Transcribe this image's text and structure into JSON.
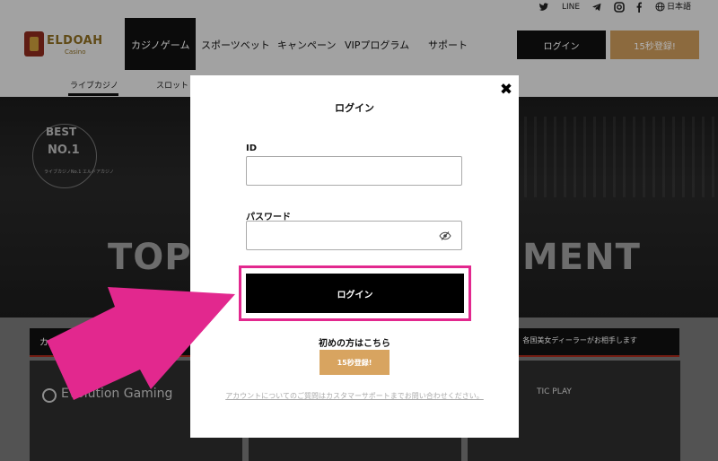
{
  "header": {
    "sns": [
      "LINE"
    ],
    "language": "日本語",
    "logo": {
      "brand": "ELDOAH",
      "sub": "Casino"
    },
    "nav": [
      "カジノゲーム",
      "スポーツベット",
      "キャンペーン",
      "VIPプログラム",
      "サポート"
    ],
    "login_button": "ログイン",
    "register_button": "15秒登録!",
    "subnav": [
      "ライブカジノ",
      "スロット"
    ]
  },
  "hero": {
    "badge_best": "BEST",
    "badge_no1": "NO.1",
    "badge_small": "ライブカジノNo.1 エルドアカジノ",
    "headline_left": "TOP",
    "headline_right": "MENT"
  },
  "categories": {
    "label": "カジノゲ",
    "right_text": "界!!　各国美女ディーラーがお相手します",
    "providers": [
      "Evolution Gaming",
      "TIC PLAY"
    ]
  },
  "modal": {
    "title": "ログイン",
    "id_label": "ID",
    "id_value": "",
    "password_label": "パスワード",
    "password_value": "",
    "login_button": "ログイン",
    "first_time": "初めの方はこちら",
    "register_button": "15秒登録!",
    "support_link": "アカウントについてのご質問はカスタマーサポートまでお問い合わせください。"
  },
  "colors": {
    "highlight": "#e2288e",
    "arrow": "#e2288e",
    "gold": "#d8a460"
  }
}
